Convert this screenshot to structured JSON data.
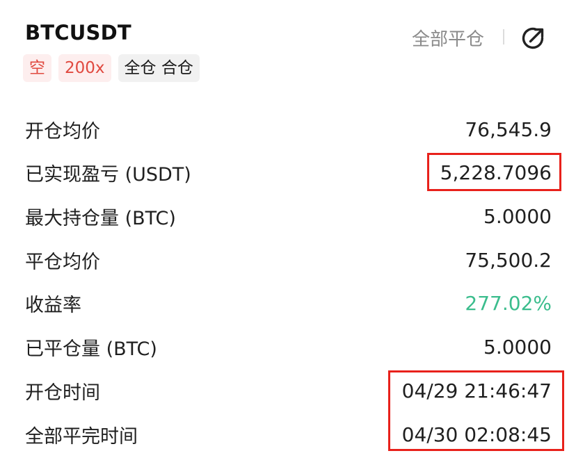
{
  "header": {
    "symbol": "BTCUSDT",
    "close_all_label": "全部平仓",
    "share_icon": "share-arrow-icon"
  },
  "tags": {
    "side": "空",
    "leverage": "200x",
    "margin_mode": "全仓 合仓"
  },
  "rows": [
    {
      "label": "开仓均价",
      "value": "76,545.9"
    },
    {
      "label": "已实现盈亏 (USDT)",
      "value": "5,228.7096"
    },
    {
      "label": "最大持仓量 (BTC)",
      "value": "5.0000"
    },
    {
      "label": "平仓均价",
      "value": "75,500.2"
    },
    {
      "label": "收益率",
      "value": "277.02%"
    },
    {
      "label": "已平仓量 (BTC)",
      "value": "5.0000"
    },
    {
      "label": "开仓时间",
      "value": "04/29 21:46:47"
    },
    {
      "label": "全部平完时间",
      "value": "04/30 02:08:45"
    }
  ],
  "colors": {
    "profit_green": "#3bbd8d",
    "short_red": "#e0493f",
    "highlight_red": "#e8211b"
  }
}
